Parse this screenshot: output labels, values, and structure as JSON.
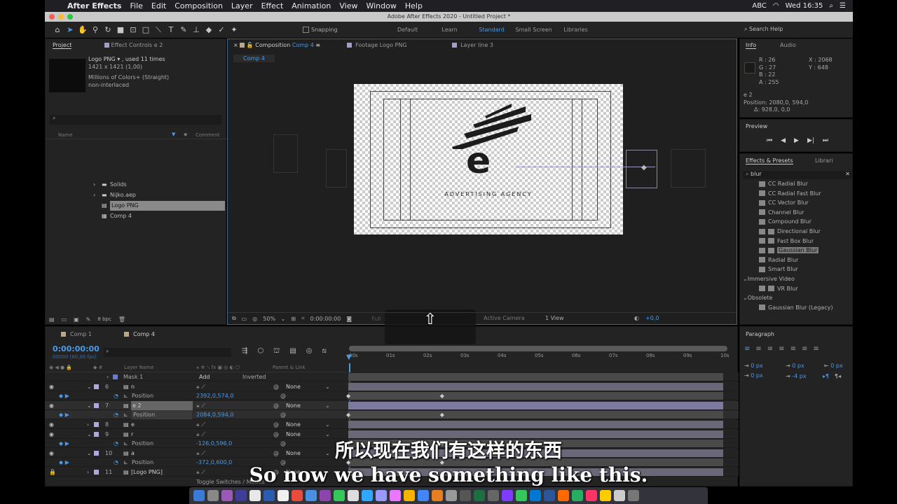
{
  "menubar": {
    "app": "After Effects",
    "items": [
      "File",
      "Edit",
      "Composition",
      "Layer",
      "Effect",
      "Animation",
      "View",
      "Window",
      "Help"
    ],
    "input_source": "ABC",
    "clock": "Wed 16:35"
  },
  "window_title": "Adobe After Effects 2020 - Untitled Project *",
  "toolbar": {
    "snapping": "Snapping",
    "workspaces": [
      "Default",
      "Learn",
      "Standard",
      "Small Screen",
      "Libraries"
    ],
    "active_workspace": "Standard",
    "search_help": "Search Help"
  },
  "project": {
    "tab": "Project",
    "tab2": "Effect Controls e 2",
    "footage_name": "Logo PNG ▾ , used 11 times",
    "footage_dims": "1421 x 1421 (1,00)",
    "footage_colors": "Millions of Colors+ (Straight)",
    "footage_interlace": "non-interlaced",
    "col_name": "Name",
    "col_comment": "Comment",
    "items": [
      {
        "name": "Solids",
        "type": "folder",
        "color": "#e8d44a"
      },
      {
        "name": "Nijko.aep",
        "type": "folder",
        "color": "#e8d44a"
      },
      {
        "name": "Logo PNG",
        "type": "footage",
        "color": "#b0a8d8",
        "selected": true
      },
      {
        "name": "Comp 4",
        "type": "comp",
        "color": "#b8a888"
      }
    ],
    "bpc": "8 bpc"
  },
  "composition": {
    "tab": "Composition",
    "comp_name": "Comp 4",
    "tab_footage": "Footage Logo PNG",
    "tab_layer": "Layer line 3",
    "breadcrumb": "Comp 4",
    "logo_text": "ADVERTISING AGENCY",
    "zoom": "50%",
    "timecode": "0:00:00:00",
    "resolution": "Full",
    "camera": "Active Camera",
    "views": "1 View",
    "exposure": "+0,0"
  },
  "info": {
    "tab": "Info",
    "tab2": "Audio",
    "r": "R : 26",
    "g": "G : 27",
    "b": "B : 22",
    "a": "A : 255",
    "x": "X : 2068",
    "y": "Y : 648",
    "layer": "e 2",
    "position": "Position: 2080,0, 594,0",
    "delta": "Δ: 928,0, 0,0"
  },
  "preview": {
    "tab": "Preview"
  },
  "effects": {
    "tab": "Effects & Presets",
    "tab2": "Librari",
    "search": "blur",
    "items": [
      {
        "label": "CC Radial Blur",
        "indent": 1
      },
      {
        "label": "CC Radial Fast Blur",
        "indent": 1
      },
      {
        "label": "CC Vector Blur",
        "indent": 1
      },
      {
        "label": "Channel Blur",
        "indent": 1
      },
      {
        "label": "Compound Blur",
        "indent": 1
      },
      {
        "label": "Directional Blur",
        "indent": 2
      },
      {
        "label": "Fast Box Blur",
        "indent": 2
      },
      {
        "label": "Gaussian Blur",
        "indent": 2,
        "selected": true
      },
      {
        "label": "Radial Blur",
        "indent": 1
      },
      {
        "label": "Smart Blur",
        "indent": 1
      },
      {
        "label": "Immersive Video",
        "indent": 0
      },
      {
        "label": "VR Blur",
        "indent": 2
      },
      {
        "label": "Obsolete",
        "indent": 0
      },
      {
        "label": "Gaussian Blur (Legacy)",
        "indent": 1
      }
    ]
  },
  "paragraph": {
    "tab": "Paragraph",
    "indent_left": "0 px",
    "indent_first": "0 px",
    "indent_right": "0 px",
    "space_before": "0 px",
    "space_after": "-4 px"
  },
  "timeline": {
    "tabs": [
      "Comp 1",
      "Comp 4"
    ],
    "active_tab": "Comp 4",
    "timecode": "0:00:00:00",
    "fps": "00000 (60,00 fps)",
    "col_layer_name": "Layer Name",
    "col_parent": "Parent & Link",
    "ticks": [
      "00s",
      "01s",
      "02s",
      "03s",
      "04s",
      "05s",
      "06s",
      "07s",
      "08s",
      "09s",
      "10s"
    ],
    "toggle": "Toggle Switches / Modes",
    "rows": [
      {
        "kind": "mask",
        "label": "Mask 1",
        "mode": "Add",
        "extra": "Inverted"
      },
      {
        "kind": "layer",
        "num": "6",
        "label": "n",
        "parent": "None",
        "open": true
      },
      {
        "kind": "prop",
        "label": "Position",
        "value": "2392,0,574,0",
        "kf": [
          0,
          0.25
        ]
      },
      {
        "kind": "layer",
        "num": "7",
        "label": "e 2",
        "parent": "None",
        "open": true,
        "selected": true
      },
      {
        "kind": "prop",
        "label": "Position",
        "value": "2084,0,594,0",
        "kf": [
          0,
          0.25
        ],
        "selected": true
      },
      {
        "kind": "layer",
        "num": "8",
        "label": "e",
        "parent": "None"
      },
      {
        "kind": "layer",
        "num": "9",
        "label": "r",
        "parent": "None",
        "open": true
      },
      {
        "kind": "prop",
        "label": "Position",
        "value": "-126,0,596,0",
        "kf": [
          0,
          0.25
        ]
      },
      {
        "kind": "layer",
        "num": "10",
        "label": "a",
        "parent": "None",
        "open": true
      },
      {
        "kind": "prop",
        "label": "Position",
        "value": "-372,0,600,0",
        "kf": [
          0,
          0.25
        ]
      },
      {
        "kind": "layer",
        "num": "11",
        "label": "[Logo PNG]",
        "parent": "None",
        "locked": true
      }
    ]
  },
  "subtitles": {
    "zh": "所以现在我们有这样的东西",
    "en": "So now we have something like this."
  },
  "colors": {
    "accent": "#4a9ae8",
    "panel": "#232323",
    "label_lavender": "#b0a8d8"
  }
}
